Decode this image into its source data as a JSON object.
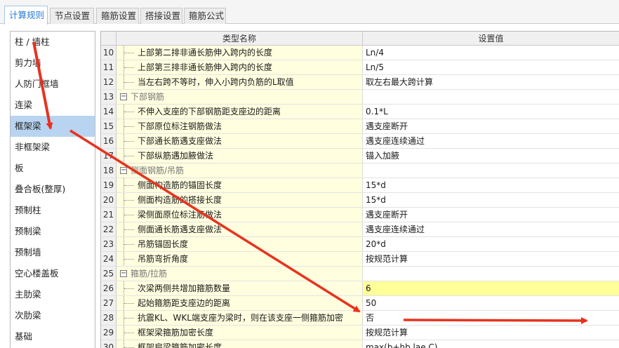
{
  "tabs": [
    {
      "label": "计算规则",
      "active": true
    },
    {
      "label": "节点设置",
      "active": false
    },
    {
      "label": "箍筋设置",
      "active": false
    },
    {
      "label": "搭接设置",
      "active": false
    },
    {
      "label": "箍筋公式",
      "active": false
    }
  ],
  "sidebar": {
    "selected": "框架梁",
    "items": [
      "柱 / 墙柱",
      "剪力墙",
      "人防门框墙",
      "连梁",
      "框架梁",
      "非框架梁",
      "板",
      "叠合板(整厚)",
      "预制柱",
      "预制梁",
      "预制墙",
      "空心楼盖板",
      "主肋梁",
      "次肋梁",
      "基础"
    ]
  },
  "grid": {
    "header_name": "类型名称",
    "header_value": "设置值",
    "rows": [
      {
        "num": "10",
        "type": "item",
        "name": "上部第二排非通长筋伸入跨内的长度",
        "value": "Ln/4"
      },
      {
        "num": "11",
        "type": "item",
        "name": "上部第三排非通长筋伸入跨内的长度",
        "value": "Ln/5"
      },
      {
        "num": "12",
        "type": "item",
        "name": "当左右跨不等时，伸入小跨内负筋的L取值",
        "value": "取左右最大跨计算"
      },
      {
        "num": "13",
        "type": "group",
        "name": "下部钢筋",
        "value": ""
      },
      {
        "num": "14",
        "type": "item",
        "name": "不伸入支座的下部钢筋距支座边的距离",
        "value": "0.1*L"
      },
      {
        "num": "15",
        "type": "item",
        "name": "下部原位标注钢筋做法",
        "value": "遇支座断开"
      },
      {
        "num": "16",
        "type": "item",
        "name": "下部通长筋遇支座做法",
        "value": "遇支座连续通过"
      },
      {
        "num": "17",
        "type": "item",
        "name": "下部纵筋遇加腋做法",
        "value": "锚入加腋"
      },
      {
        "num": "18",
        "type": "group",
        "name": "侧面钢筋/吊筋",
        "value": ""
      },
      {
        "num": "19",
        "type": "item",
        "name": "侧面构造筋的锚固长度",
        "value": "15*d"
      },
      {
        "num": "20",
        "type": "item",
        "name": "侧面构造筋的搭接长度",
        "value": "15*d"
      },
      {
        "num": "21",
        "type": "item",
        "name": "梁侧面原位标注筋做法",
        "value": "遇支座断开"
      },
      {
        "num": "22",
        "type": "item",
        "name": "侧面通长筋遇支座做法",
        "value": "遇支座连续通过"
      },
      {
        "num": "23",
        "type": "item",
        "name": "吊筋锚固长度",
        "value": "20*d"
      },
      {
        "num": "24",
        "type": "item",
        "name": "吊筋弯折角度",
        "value": "按规范计算"
      },
      {
        "num": "25",
        "type": "group",
        "name": "箍筋/拉筋",
        "value": ""
      },
      {
        "num": "26",
        "type": "item",
        "name": "次梁两侧共增加箍筋数量",
        "value": "6",
        "highlight": true
      },
      {
        "num": "27",
        "type": "item",
        "name": "起始箍筋距支座边的距离",
        "value": "50"
      },
      {
        "num": "28",
        "type": "item",
        "name": "抗震KL、WKL端支座为梁时，则在该支座一侧箍筋加密",
        "value": "否"
      },
      {
        "num": "29",
        "type": "item",
        "name": "框架梁箍筋加密长度",
        "value": "按规范计算"
      },
      {
        "num": "30",
        "type": "item",
        "name": "框架扁梁箍筋加密长度",
        "value": "max(b+hb,lae,C)"
      }
    ]
  },
  "annotation": {
    "color": "#e8321e"
  }
}
